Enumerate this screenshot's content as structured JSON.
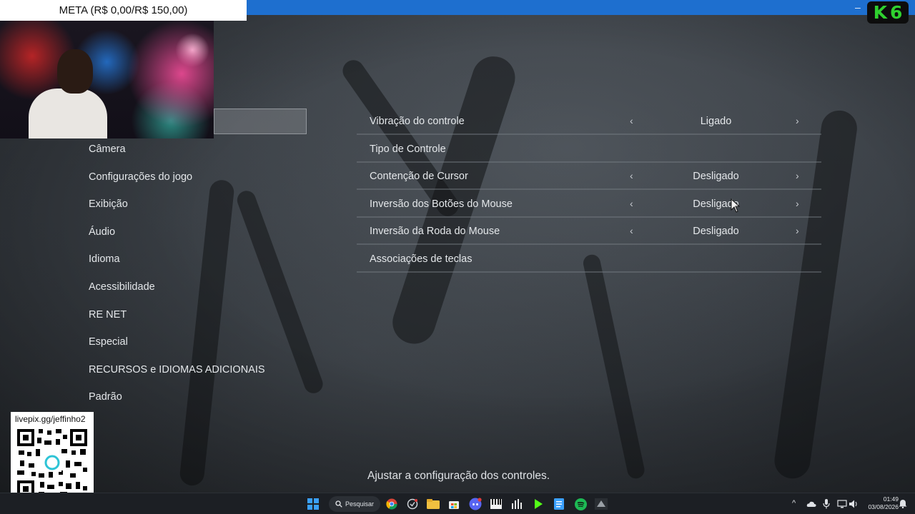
{
  "overlay": {
    "meta_label": "META (R$ 0,00/R$ 150,00)",
    "k6_logo_letter": "K",
    "k6_logo_number": "6",
    "qr_url": "livepix.gg/jeffinho2"
  },
  "menu": {
    "items": [
      {
        "label": "Câmera"
      },
      {
        "label": "Configurações do jogo"
      },
      {
        "label": "Exibição"
      },
      {
        "label": "Áudio"
      },
      {
        "label": "Idioma"
      },
      {
        "label": "Acessibilidade"
      },
      {
        "label": "RE NET"
      },
      {
        "label": "Especial"
      },
      {
        "label": "RECURSOS e IDIOMAS ADICIONAIS"
      },
      {
        "label": "Padrão"
      }
    ]
  },
  "options": {
    "rows": [
      {
        "label": "Vibração do controle",
        "value": "Ligado",
        "has_arrows": true
      },
      {
        "label": "Tipo de Controle",
        "value": "",
        "has_arrows": false
      },
      {
        "label": "Contenção de Cursor",
        "value": "Desligado",
        "has_arrows": true
      },
      {
        "label": "Inversão dos Botões do Mouse",
        "value": "Desligado",
        "has_arrows": true
      },
      {
        "label": "Inversão da Roda do Mouse",
        "value": "Desligado",
        "has_arrows": true
      },
      {
        "label": "Associações de teclas",
        "value": "",
        "has_arrows": false
      }
    ],
    "arrow_left": "‹",
    "arrow_right": "›"
  },
  "hint": "Ajustar a configuração dos controles.",
  "taskbar": {
    "search_label": "Pesquisar",
    "time": "01:49",
    "date": "03/08/2026",
    "icons": [
      "windows-start-icon",
      "chrome-icon",
      "app-icon",
      "file-explorer-icon",
      "store-icon",
      "discord-icon",
      "piano-icon",
      "audio-app-icon",
      "play-icon",
      "notepad-icon",
      "spotify-icon",
      "game-icon"
    ]
  },
  "colors": {
    "window_bar": "#1e6fcf",
    "logo_green": "#2fd12f",
    "spotify_green": "#1db954"
  }
}
